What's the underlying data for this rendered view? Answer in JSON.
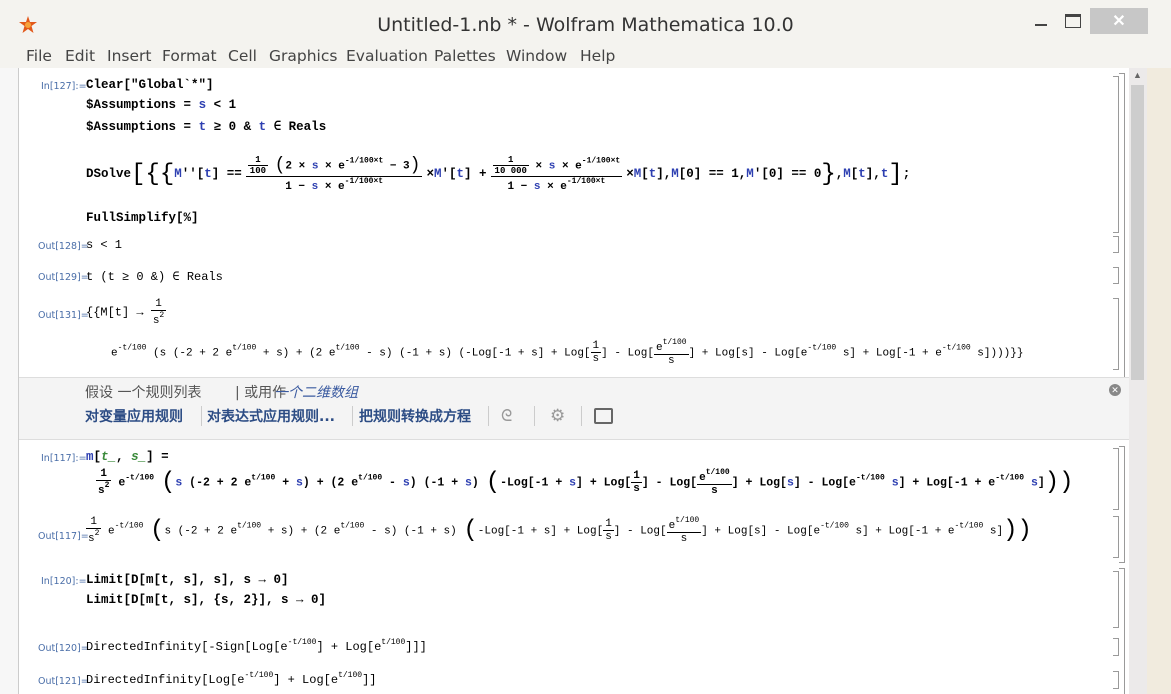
{
  "window": {
    "title": "Untitled-1.nb * - Wolfram Mathematica 10.0"
  },
  "menu": [
    "File",
    "Edit",
    "Insert",
    "Format",
    "Cell",
    "Graphics",
    "Evaluation",
    "Palettes",
    "Window",
    "Help"
  ],
  "cells": {
    "in127": {
      "label": "In[127]:=",
      "l1": "Clear[\"Global`*\"]",
      "l2a": "$Assumptions",
      "l2b": "=",
      "l2c": "s",
      "l2d": "< 1",
      "l3a": "$Assumptions",
      "l3b": "=",
      "l3c": "t",
      "l3d": "≥ 0 &",
      "l3e": "t",
      "l3f": "∈ Reals",
      "dsolve": "DSolve",
      "l5": "FullSimplify[%]"
    },
    "out128": {
      "label": "Out[128]=",
      "text": "s < 1"
    },
    "out129": {
      "label": "Out[129]=",
      "text": "t (t ≥ 0 &) ∈ Reals"
    },
    "out131": {
      "label": "Out[131]="
    },
    "assistant": {
      "hint1": "假设 一个规则列表",
      "hint_sep": "| 或用作",
      "hint2": "一个二维数组",
      "btn1": "对变量应用规则",
      "btn2": "对表达式应用规则...",
      "btn3": "把规则转换成方程"
    },
    "in117": {
      "label": "In[117]:="
    },
    "out117": {
      "label": "Out[117]="
    },
    "in120": {
      "label": "In[120]:=",
      "l1": "Limit[D[m[t, s], s], s → 0]",
      "l2": "Limit[D[m[t, s], {s, 2}], s → 0]"
    },
    "out120": {
      "label": "Out[120]=",
      "head": "DirectedInfinity"
    },
    "out121": {
      "label": "Out[121]=",
      "head": "DirectedInfinity"
    }
  }
}
